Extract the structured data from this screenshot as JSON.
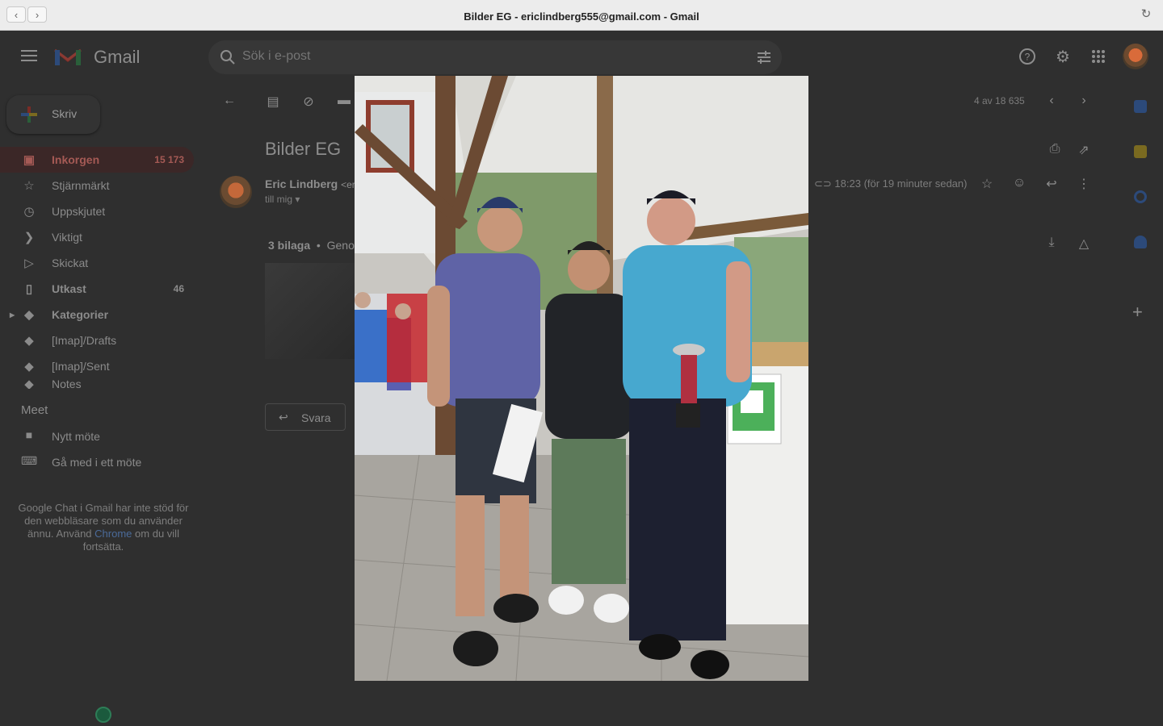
{
  "window": {
    "title": "Bilder EG - ericlindberg555@gmail.com - Gmail"
  },
  "gmail": {
    "logo_text": "Gmail",
    "search_placeholder": "Sök i e-post",
    "compose_label": "Skriv",
    "sidebar": [
      {
        "label": "Inkorgen",
        "count": "15 173"
      },
      {
        "label": "Stjärnmärkt",
        "count": ""
      },
      {
        "label": "Uppskjutet",
        "count": ""
      },
      {
        "label": "Viktigt",
        "count": ""
      },
      {
        "label": "Skickat",
        "count": ""
      },
      {
        "label": "Utkast",
        "count": "46"
      },
      {
        "label": "Kategorier",
        "count": ""
      },
      {
        "label": "[Imap]/Drafts",
        "count": ""
      },
      {
        "label": "[Imap]/Sent",
        "count": ""
      },
      {
        "label": "Notes",
        "count": ""
      }
    ],
    "meet": {
      "heading": "Meet",
      "new_meeting": "Nytt möte",
      "join_meeting": "Gå med i ett möte"
    },
    "chat_note": {
      "text": "Google Chat i Gmail har inte stöd för den webbläsare som du använder ännu. Använd",
      "link": "Chrome",
      "tail": "om du vill fortsätta."
    },
    "email": {
      "subject": "Bilder EG",
      "sender_name": "Eric Lindberg",
      "sender_email_fragment": "<eri",
      "to": "till mig",
      "timestamp": "18:23 (för 19 minuter sedan)",
      "pager": "4 av 18 635",
      "attachments_label": "3 bilaga",
      "attachments_scan": "Genom",
      "reply_label": "Svara"
    }
  },
  "viewer": {
    "photo": "group-photo-three-men-golf-trophy"
  }
}
